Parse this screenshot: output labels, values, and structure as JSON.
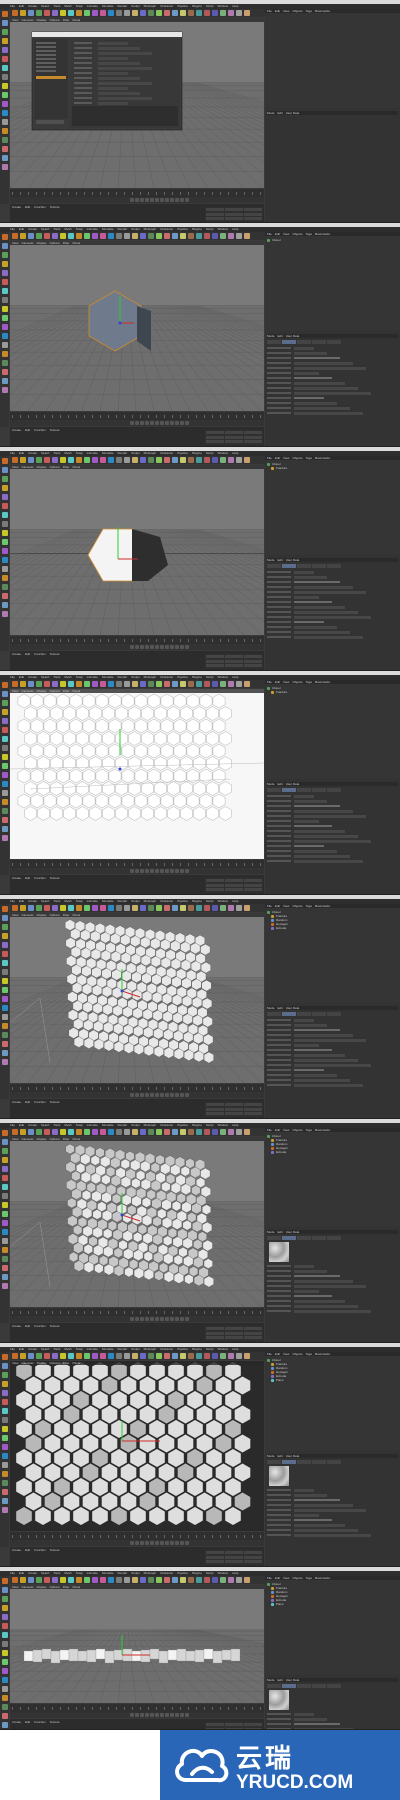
{
  "app": {
    "menu": [
      "File",
      "Edit",
      "Create",
      "Select",
      "Tools",
      "Mesh",
      "Snap",
      "Animate",
      "Simulate",
      "Render",
      "Sculpt",
      "MoGraph",
      "Character",
      "Pipeline",
      "Plugins",
      "Script",
      "Window",
      "Help"
    ],
    "viewport_menu": [
      "View",
      "Cameras",
      "Display",
      "Options",
      "Filter",
      "Panel"
    ],
    "viewport_label": "Perspective",
    "materials_menu": [
      "Create",
      "Edit",
      "Function",
      "Texture"
    ],
    "objects_menu": [
      "File",
      "Edit",
      "View",
      "Objects",
      "Tags",
      "Bookmarks"
    ],
    "attributes_menu": [
      "Mode",
      "Edit",
      "User Data"
    ],
    "render_settings_title": "Render Settings",
    "render_settings_button": "Render Setting...",
    "object_names": [
      "Cloner",
      "Fracture",
      "Random",
      "Hexagon",
      "Extrude",
      "Plane"
    ]
  },
  "watermark": {
    "chinese": "云瑞",
    "domain": "YRUCD.COM"
  }
}
